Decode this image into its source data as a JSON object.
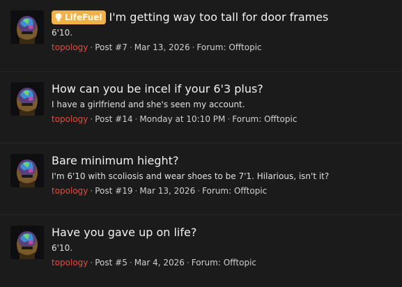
{
  "results": [
    {
      "label": "LifeFuel",
      "title": "I'm getting way too tall for door frames",
      "snippet": "6'10.",
      "author": "topology",
      "post": "Post #7",
      "date": "Mar 13, 2026",
      "forum_prefix": "Forum:",
      "forum": "Offtopic"
    },
    {
      "label": "",
      "title": "How can you be incel if your 6'3 plus?",
      "snippet": "I have a girlfriend and she's seen my account.",
      "author": "topology",
      "post": "Post #14",
      "date": "Monday at 10:10 PM",
      "forum_prefix": "Forum:",
      "forum": "Offtopic"
    },
    {
      "label": "",
      "title": "Bare minimum hieght?",
      "snippet": "I'm 6'10 with scoliosis and wear shoes to be 7'1. Hilarious, isn't it?",
      "author": "topology",
      "post": "Post #19",
      "date": "Mar 13, 2026",
      "forum_prefix": "Forum:",
      "forum": "Offtopic"
    },
    {
      "label": "",
      "title": "Have you gave up on life?",
      "snippet": "6'10.",
      "author": "topology",
      "post": "Post #5",
      "date": "Mar 4, 2026",
      "forum_prefix": "Forum:",
      "forum": "Offtopic"
    }
  ],
  "separator": "·",
  "colors": {
    "background": "#1b1b1b",
    "author": "#e84b3c",
    "label_background": "#f0b14a"
  },
  "icons": {
    "label_icon": "lightbulb-icon",
    "avatar": "user-avatar"
  }
}
